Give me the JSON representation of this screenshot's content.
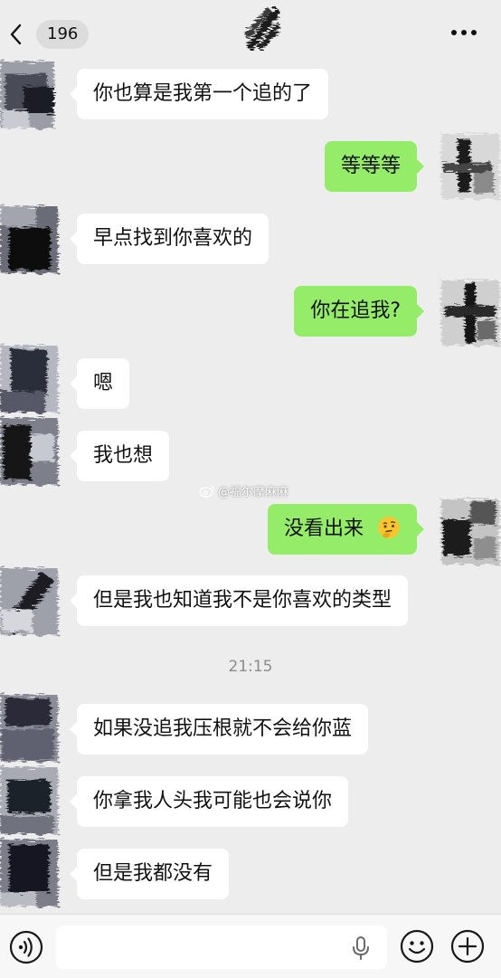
{
  "header": {
    "unread_count": "196"
  },
  "messages": [
    {
      "side": "in",
      "text": "你也算是我第一个追的了"
    },
    {
      "side": "out",
      "text": "等等等"
    },
    {
      "side": "in",
      "text": "早点找到你喜欢的"
    },
    {
      "side": "out",
      "text": "你在追我?"
    },
    {
      "side": "in",
      "text": "嗯"
    },
    {
      "side": "in",
      "text": "我也想"
    },
    {
      "side": "out",
      "text": "没看出来",
      "emoji": "thinking-face"
    },
    {
      "side": "in",
      "text": "但是我也知道我不是你喜欢的类型"
    },
    {
      "side": "in",
      "text": "如果没追我压根就不会给你蓝"
    },
    {
      "side": "in",
      "text": "你拿我人头我可能也会说你"
    },
    {
      "side": "in",
      "text": "但是我都没有"
    }
  ],
  "time_divider": "21:15",
  "watermark": "@福尔摩麻麻",
  "colors": {
    "background": "#ededed",
    "outgoing_bubble": "#95ec69",
    "incoming_bubble": "#ffffff",
    "timestamp": "#8c8c8c"
  },
  "icons": {
    "back": "chevron-left-icon",
    "more": "more-dots-icon",
    "voice": "voice-mode-icon",
    "mic": "microphone-icon",
    "emoji": "smiley-face-icon",
    "plus": "plus-circle-icon"
  }
}
